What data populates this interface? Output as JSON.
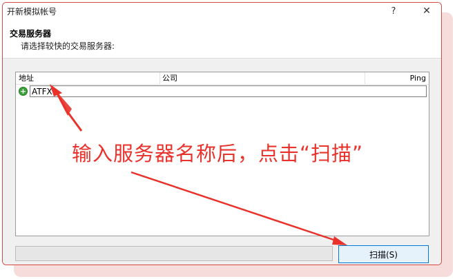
{
  "window": {
    "title": "开新模拟帐号",
    "help_glyph": "?",
    "close_glyph": "✕"
  },
  "header": {
    "title": "交易服务器",
    "subtitle": "请选择较快的交易服务器:"
  },
  "list": {
    "columns": [
      "地址",
      "公司",
      "Ping"
    ],
    "rows": [
      {
        "address": "ATFX",
        "company": "",
        "ping": ""
      }
    ]
  },
  "progress": {
    "value": 0
  },
  "buttons": {
    "scan_label": "扫描(S)"
  },
  "annotation": {
    "text": "输入服务器名称后，点击“扫描”",
    "color": "#e8322b"
  },
  "colors": {
    "dialog_border": "#d5483f",
    "button_focus_border": "#0078d7",
    "row_icon": "#3aa33a"
  },
  "icons": [
    "help-icon",
    "close-icon",
    "add-server-icon"
  ]
}
